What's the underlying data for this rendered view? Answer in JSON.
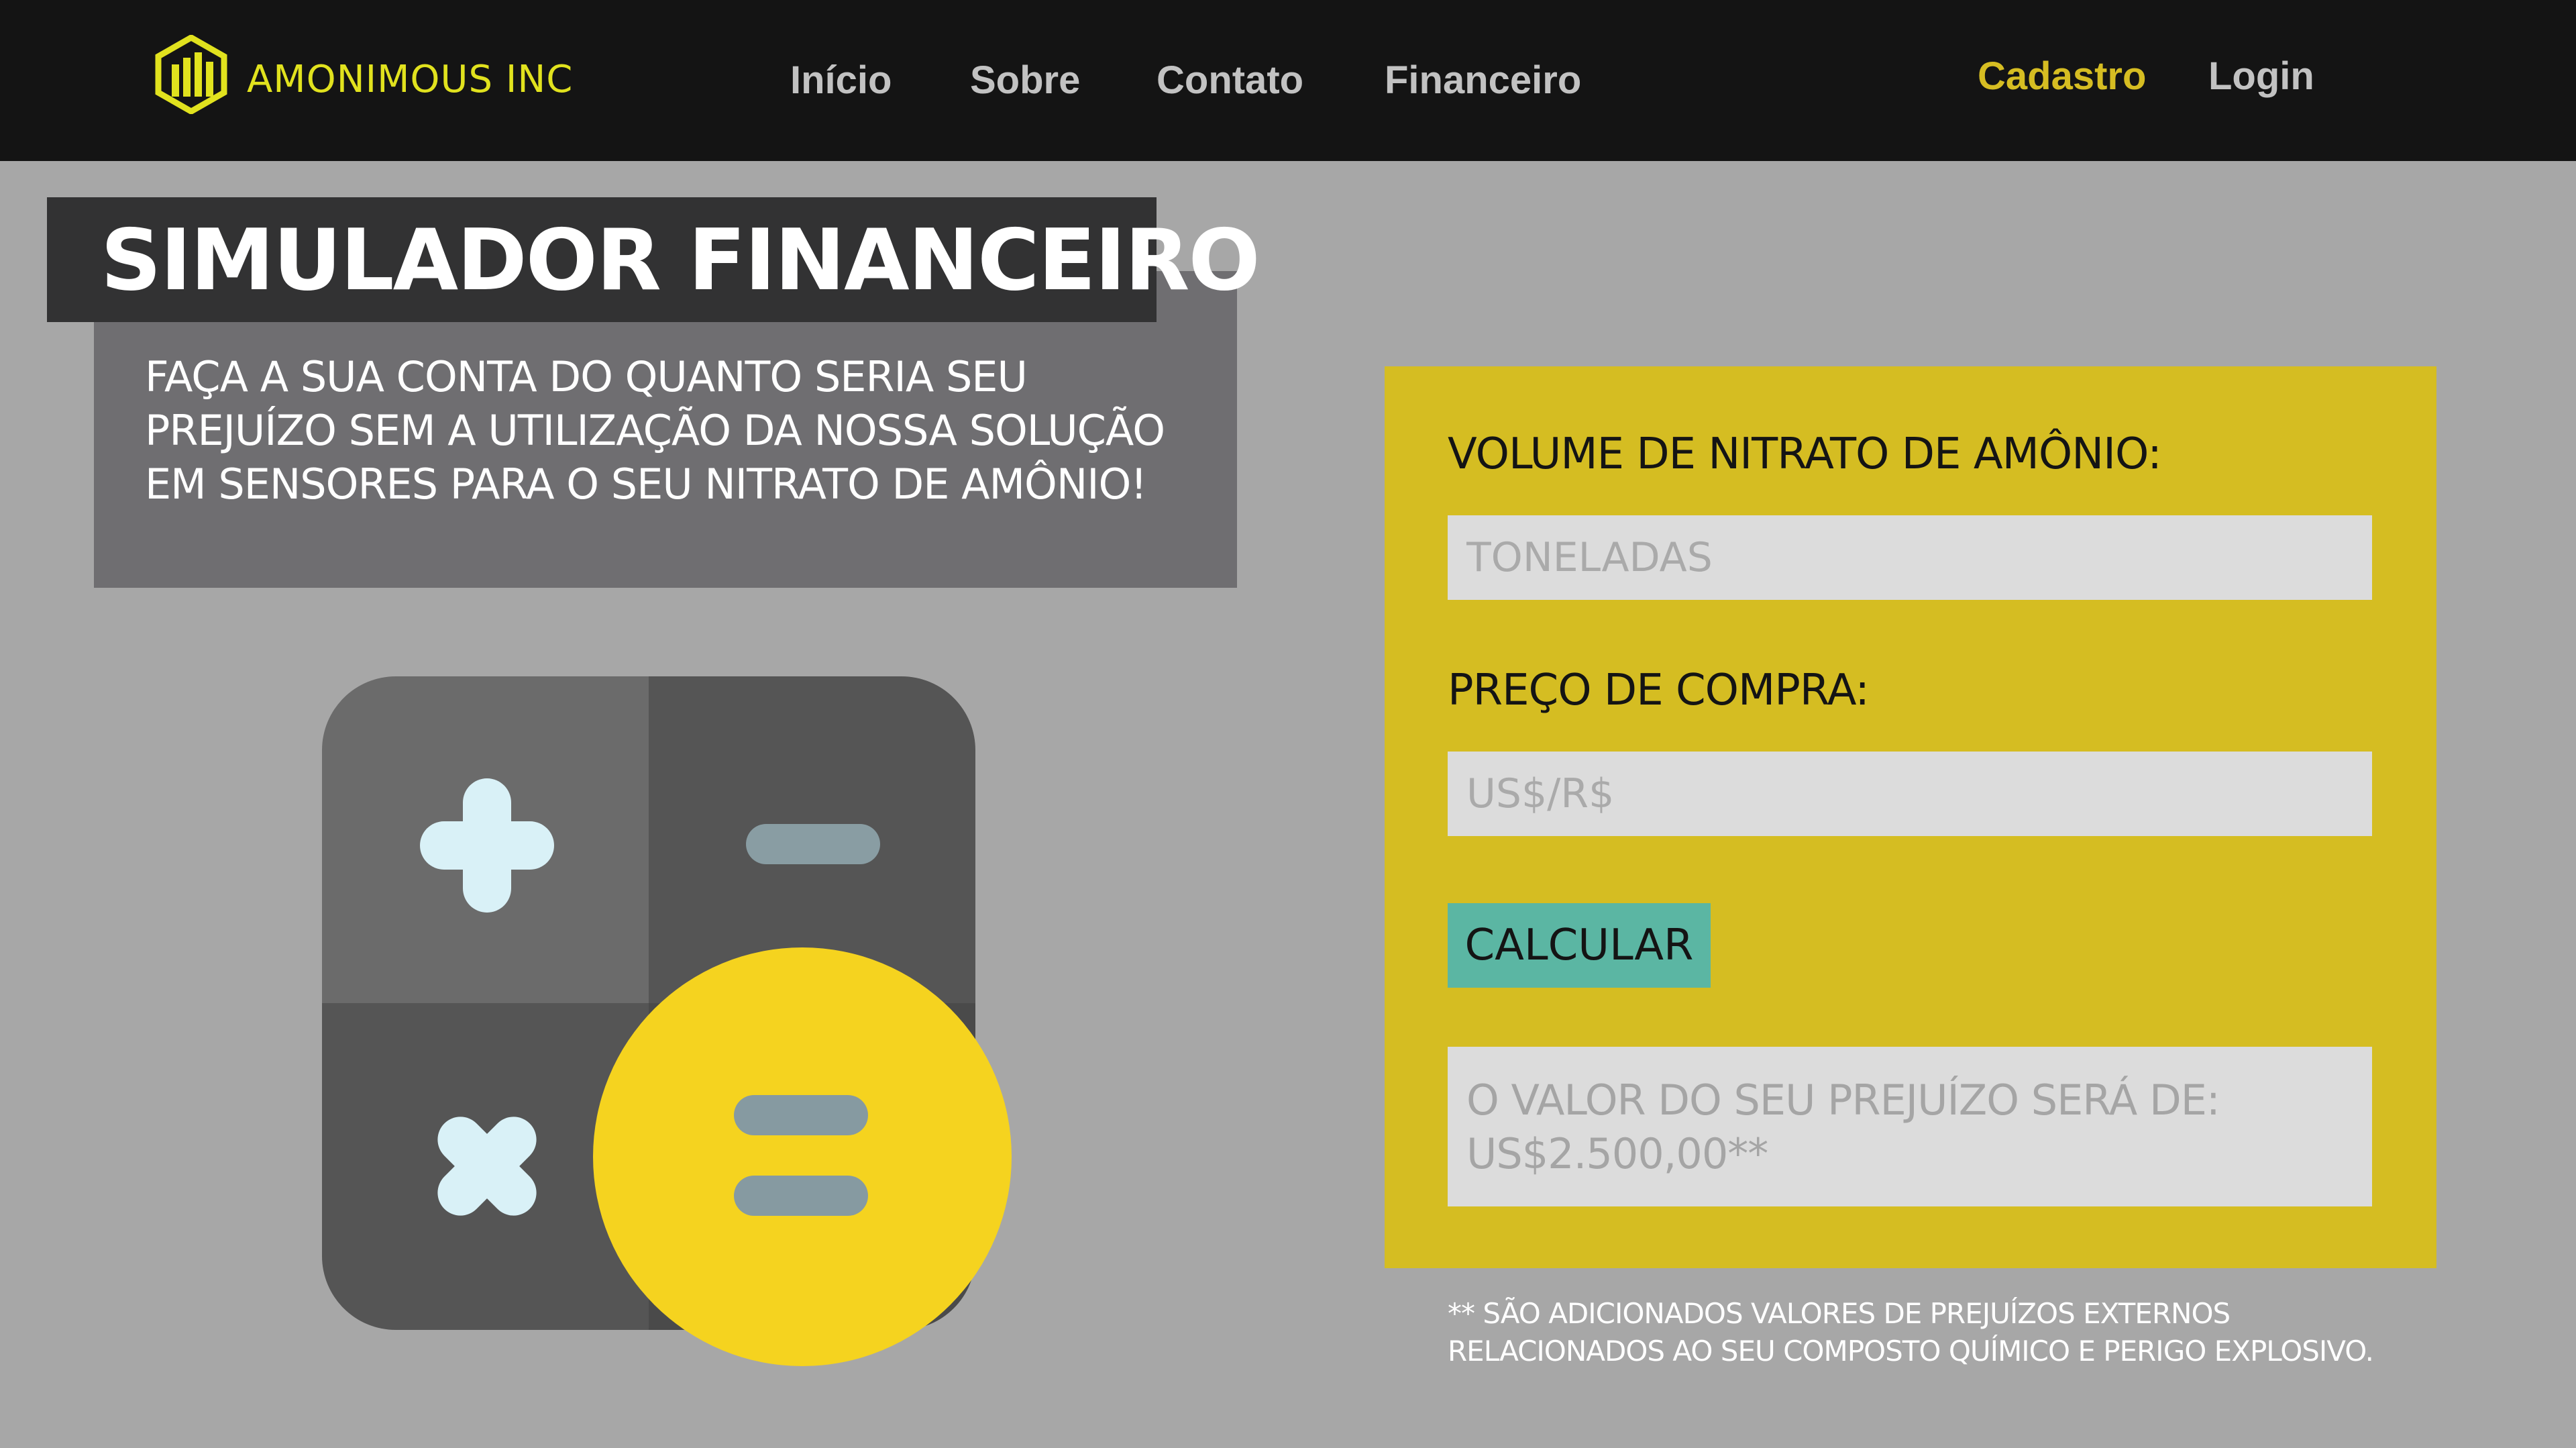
{
  "nav": {
    "brand": "AMONIMOUS INC",
    "links": [
      "Início",
      "Sobre",
      "Contato",
      "Financeiro"
    ],
    "signup": "Cadastro",
    "login": "Login"
  },
  "hero": {
    "title": "SIMULADOR FINANCEIRO",
    "subtitle": "FAÇA A SUA CONTA DO QUANTO SERIA SEU PREJUÍZO SEM A UTILIZAÇÃO DA NOSSA SOLUÇÃO EM SENSORES PARA O SEU NITRATO DE AMÔNIO!"
  },
  "form": {
    "volume_label": "VOLUME DE NITRATO DE AMÔNIO:",
    "volume_placeholder": "TONELADAS",
    "price_label": "PREÇO DE COMPRA:",
    "price_placeholder": "US$/R$",
    "button_label": "CALCULAR",
    "result_text": "O VALOR DO SEU PREJUÍZO SERÁ DE: US$2.500,00**",
    "footnote": "** SÃO ADICIONADOS VALORES DE PREJUÍZOS EXTERNOS RELACIONADOS AO SEU COMPOSTO QUÍMICO E PERIGO EXPLOSIVO."
  },
  "colors": {
    "navbar": "#141414",
    "background": "#a7a7a7",
    "accent_yellow": "#d5bd22",
    "button_teal": "#5bb6a3",
    "title_dark": "#323233",
    "title_panel": "#6f6e71"
  },
  "icons": {
    "logo": "building-bars-hexagon-icon",
    "illustration": "calculator-icon"
  }
}
